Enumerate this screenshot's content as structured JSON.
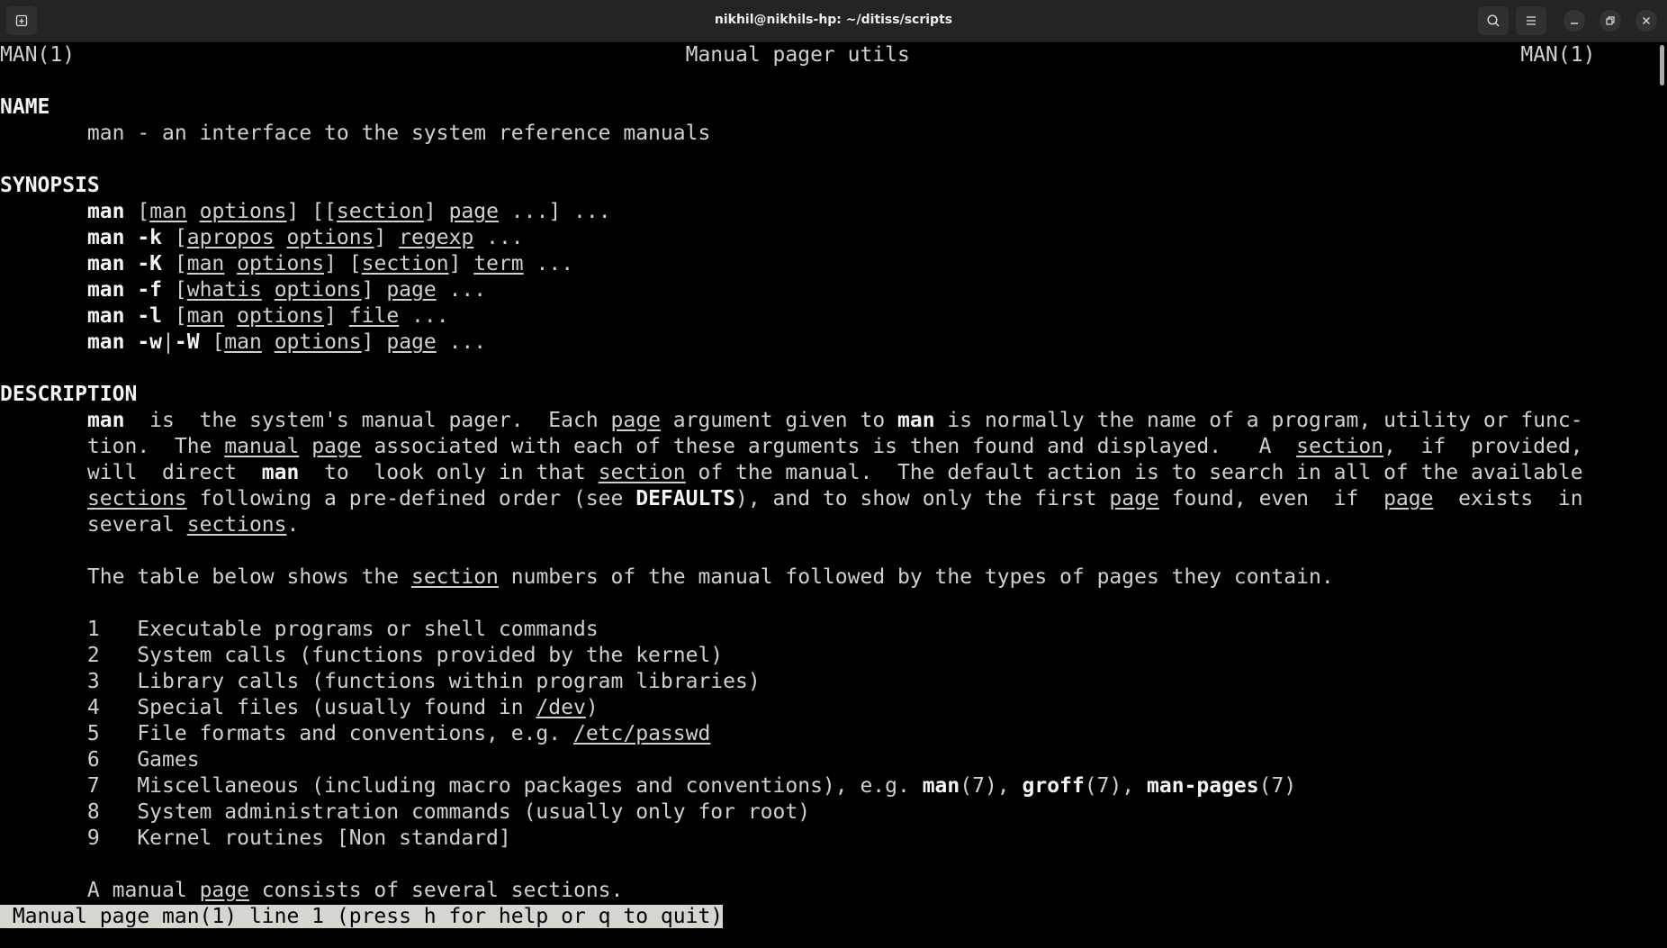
{
  "window": {
    "title": "nikhil@nikhils-hp: ~/ditiss/scripts",
    "buttons": [
      "new-tab-icon",
      "search-icon",
      "hamburger-menu-icon",
      "minimize-icon",
      "maximize-icon",
      "close-icon"
    ]
  },
  "colors": {
    "titlebar": "#242424",
    "terminal_bg": "#000000",
    "text": "#d0d0cc",
    "status_bg": "#d3d7cf"
  },
  "terminal": {
    "lines": [
      [
        [
          "MAN(1)                                                 Manual pager utils                                                 MAN(1)",
          ""
        ]
      ],
      [],
      [
        [
          "NAME",
          "b"
        ]
      ],
      [
        [
          "       man - an interface to the system reference manuals",
          ""
        ]
      ],
      [],
      [
        [
          "SYNOPSIS",
          "b"
        ]
      ],
      [
        [
          "       ",
          ""
        ],
        [
          "man",
          "b"
        ],
        [
          " [",
          ""
        ],
        [
          "man",
          "u"
        ],
        [
          " ",
          ""
        ],
        [
          "options",
          "u"
        ],
        [
          "] [[",
          ""
        ],
        [
          "section",
          "u"
        ],
        [
          "] ",
          ""
        ],
        [
          "page",
          "u"
        ],
        [
          " ...] ...",
          ""
        ]
      ],
      [
        [
          "       ",
          ""
        ],
        [
          "man -k",
          "b"
        ],
        [
          " [",
          ""
        ],
        [
          "apropos",
          "u"
        ],
        [
          " ",
          ""
        ],
        [
          "options",
          "u"
        ],
        [
          "] ",
          ""
        ],
        [
          "regexp",
          "u"
        ],
        [
          " ...",
          ""
        ]
      ],
      [
        [
          "       ",
          ""
        ],
        [
          "man -K",
          "b"
        ],
        [
          " [",
          ""
        ],
        [
          "man",
          "u"
        ],
        [
          " ",
          ""
        ],
        [
          "options",
          "u"
        ],
        [
          "] [",
          ""
        ],
        [
          "section",
          "u"
        ],
        [
          "] ",
          ""
        ],
        [
          "term",
          "u"
        ],
        [
          " ...",
          ""
        ]
      ],
      [
        [
          "       ",
          ""
        ],
        [
          "man -f",
          "b"
        ],
        [
          " [",
          ""
        ],
        [
          "whatis",
          "u"
        ],
        [
          " ",
          ""
        ],
        [
          "options",
          "u"
        ],
        [
          "] ",
          ""
        ],
        [
          "page",
          "u"
        ],
        [
          " ...",
          ""
        ]
      ],
      [
        [
          "       ",
          ""
        ],
        [
          "man -l",
          "b"
        ],
        [
          " [",
          ""
        ],
        [
          "man",
          "u"
        ],
        [
          " ",
          ""
        ],
        [
          "options",
          "u"
        ],
        [
          "] ",
          ""
        ],
        [
          "file",
          "u"
        ],
        [
          " ...",
          ""
        ]
      ],
      [
        [
          "       ",
          ""
        ],
        [
          "man -w",
          "b"
        ],
        [
          "|",
          ""
        ],
        [
          "-W",
          "b"
        ],
        [
          " [",
          ""
        ],
        [
          "man",
          "u"
        ],
        [
          " ",
          ""
        ],
        [
          "options",
          "u"
        ],
        [
          "] ",
          ""
        ],
        [
          "page",
          "u"
        ],
        [
          " ...",
          ""
        ]
      ],
      [],
      [
        [
          "DESCRIPTION",
          "b"
        ]
      ],
      [
        [
          "       ",
          ""
        ],
        [
          "man",
          "b"
        ],
        [
          "  is  the system's manual pager.  Each ",
          ""
        ],
        [
          "page",
          "u"
        ],
        [
          " argument given to ",
          ""
        ],
        [
          "man",
          "b"
        ],
        [
          " is normally the name of a program, utility or func-",
          ""
        ]
      ],
      [
        [
          "       tion.  The ",
          ""
        ],
        [
          "manual",
          "u"
        ],
        [
          " ",
          ""
        ],
        [
          "page",
          "u"
        ],
        [
          " associated with each of these arguments is then found and displayed.   A  ",
          ""
        ],
        [
          "section",
          "u"
        ],
        [
          ",  if  provided,",
          ""
        ]
      ],
      [
        [
          "       will  direct  ",
          ""
        ],
        [
          "man",
          "b"
        ],
        [
          "  to  look only in that ",
          ""
        ],
        [
          "section",
          "u"
        ],
        [
          " of the manual.  The default action is to search in all of the available",
          ""
        ]
      ],
      [
        [
          "       ",
          ""
        ],
        [
          "sections",
          "u"
        ],
        [
          " following a pre-defined order (see ",
          ""
        ],
        [
          "DEFAULTS",
          "b"
        ],
        [
          "), and to show only the first ",
          ""
        ],
        [
          "page",
          "u"
        ],
        [
          " found, even  if  ",
          ""
        ],
        [
          "page",
          "u"
        ],
        [
          "  exists  in",
          ""
        ]
      ],
      [
        [
          "       several ",
          ""
        ],
        [
          "sections",
          "u"
        ],
        [
          ".",
          ""
        ]
      ],
      [],
      [
        [
          "       The table below shows the ",
          ""
        ],
        [
          "section",
          "u"
        ],
        [
          " numbers of the manual followed by the types of pages they contain.",
          ""
        ]
      ],
      [],
      [
        [
          "       1   Executable programs or shell commands",
          ""
        ]
      ],
      [
        [
          "       2   System calls (functions provided by the kernel)",
          ""
        ]
      ],
      [
        [
          "       3   Library calls (functions within program libraries)",
          ""
        ]
      ],
      [
        [
          "       4   Special files (usually found in ",
          ""
        ],
        [
          "/dev",
          "u"
        ],
        [
          ")",
          ""
        ]
      ],
      [
        [
          "       5   File formats and conventions, e.g. ",
          ""
        ],
        [
          "/etc/passwd",
          "u"
        ]
      ],
      [
        [
          "       6   Games",
          ""
        ]
      ],
      [
        [
          "       7   Miscellaneous (including macro packages and conventions), e.g. ",
          ""
        ],
        [
          "man",
          "b"
        ],
        [
          "(7), ",
          ""
        ],
        [
          "groff",
          "b"
        ],
        [
          "(7), ",
          ""
        ],
        [
          "man-pages",
          "b"
        ],
        [
          "(7)",
          ""
        ]
      ],
      [
        [
          "       8   System administration commands (usually only for root)",
          ""
        ]
      ],
      [
        [
          "       9   Kernel routines [Non standard]",
          ""
        ]
      ],
      [],
      [
        [
          "       A manual ",
          ""
        ],
        [
          "page",
          "u"
        ],
        [
          " consists of several sections.",
          ""
        ]
      ]
    ],
    "status": " Manual page man(1) line 1 (press h for help or q to quit)"
  }
}
